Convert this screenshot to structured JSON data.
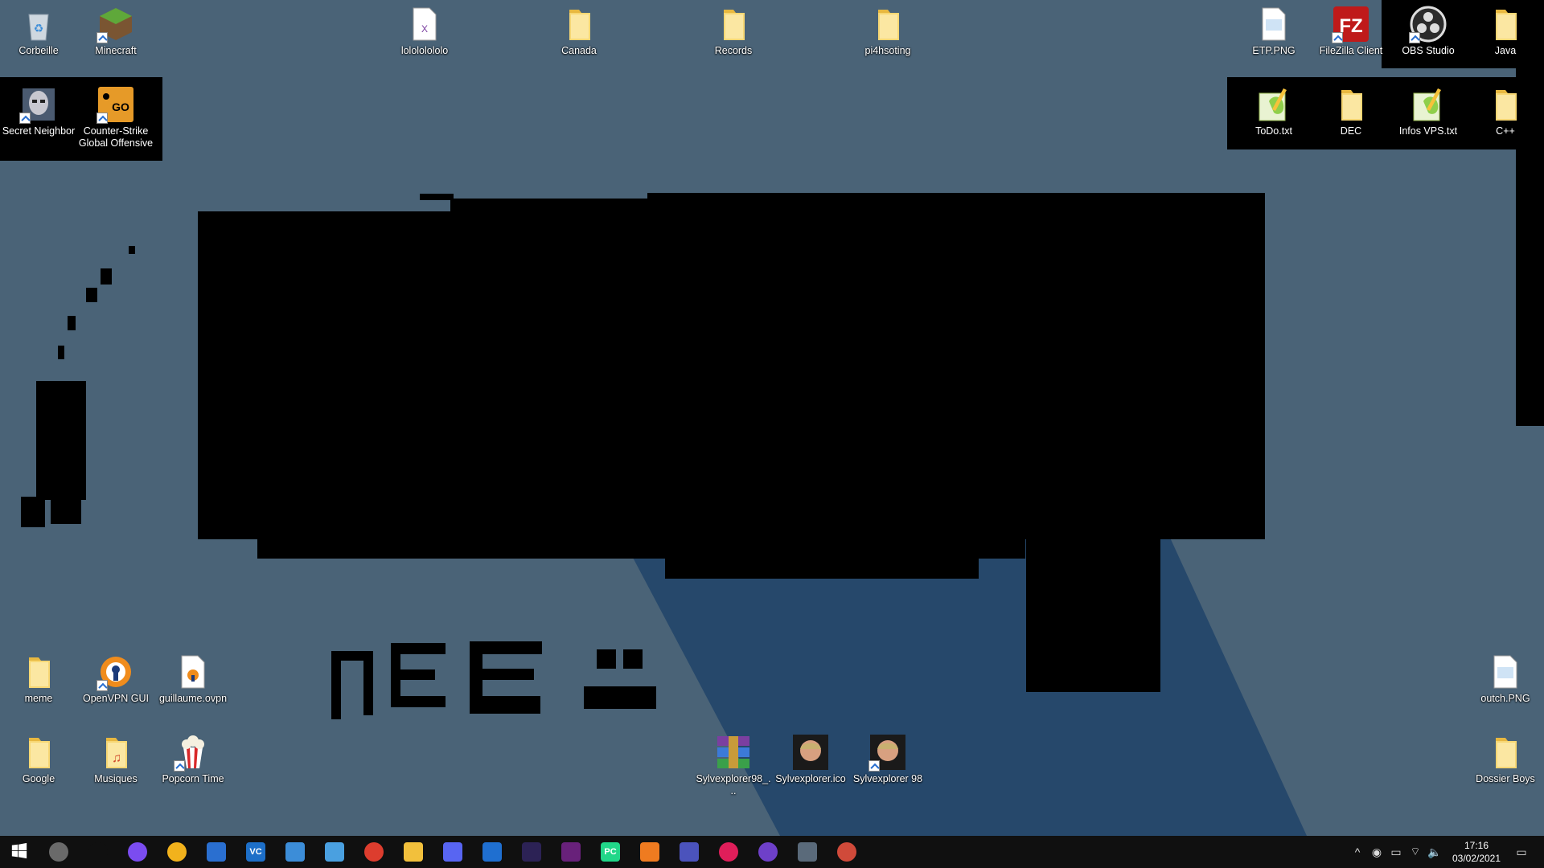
{
  "desktop": {
    "icons_left": [
      {
        "label": "Corbeille",
        "icon": "recycle-bin-icon"
      },
      {
        "label": "Minecraft",
        "icon": "minecraft-icon"
      },
      {
        "label": "Secret Neighbor",
        "icon": "secret-neighbor-icon"
      },
      {
        "label": "Counter-Strike Global Offensive",
        "icon": "csgo-icon"
      }
    ],
    "icons_top": [
      {
        "label": "lolololololo",
        "icon": "xml-file-icon"
      },
      {
        "label": "Canada",
        "icon": "folder-icon"
      },
      {
        "label": "Records",
        "icon": "folder-icon"
      },
      {
        "label": "pi4hsoting",
        "icon": "folder-icon"
      }
    ],
    "icons_right": [
      {
        "label": "ETP.PNG",
        "icon": "image-file-icon"
      },
      {
        "label": "FileZilla Client",
        "icon": "filezilla-icon"
      },
      {
        "label": "OBS Studio",
        "icon": "obs-icon"
      },
      {
        "label": "Java",
        "icon": "folder-icon"
      },
      {
        "label": "ToDo.txt",
        "icon": "notepadpp-file-icon"
      },
      {
        "label": "DEC",
        "icon": "folder-icon"
      },
      {
        "label": "Infos VPS.txt",
        "icon": "notepadpp-file-icon"
      },
      {
        "label": "C++",
        "icon": "folder-icon"
      },
      {
        "label": "outch.PNG",
        "icon": "image-file-icon"
      },
      {
        "label": "Dossier Boys",
        "icon": "folder-icon"
      }
    ],
    "icons_bottom_left": [
      {
        "label": "meme",
        "icon": "folder-icon"
      },
      {
        "label": "OpenVPN GUI",
        "icon": "openvpn-icon"
      },
      {
        "label": "guillaume.ovpn",
        "icon": "ovpn-file-icon"
      },
      {
        "label": "Google",
        "icon": "folder-icon"
      },
      {
        "label": "Musiques",
        "icon": "music-folder-icon"
      },
      {
        "label": "Popcorn Time",
        "icon": "popcorn-icon"
      }
    ],
    "icons_bottom_center": [
      {
        "label": "Sylvexplorer98_...",
        "icon": "winrar-icon"
      },
      {
        "label": "Sylvexplorer.ico",
        "icon": "portrait-icon"
      },
      {
        "label": "Sylvexplorer 98",
        "icon": "portrait-icon"
      }
    ],
    "drawing_text": "REE :-"
  },
  "taskbar": {
    "apps": [
      {
        "name": "start-icon",
        "glyph": ""
      },
      {
        "name": "cortana-icon",
        "glyph": ""
      },
      {
        "name": "speedometer-icon",
        "glyph": ""
      },
      {
        "name": "messenger-icon",
        "glyph": ""
      },
      {
        "name": "chat-alert-icon",
        "glyph": ""
      },
      {
        "name": "network-tool-icon",
        "glyph": ""
      },
      {
        "name": "vscode-icon",
        "glyph": "VC"
      },
      {
        "name": "control-panel-icon",
        "glyph": ""
      },
      {
        "name": "remote-desktop-icon",
        "glyph": ""
      },
      {
        "name": "chrome-icon",
        "glyph": ""
      },
      {
        "name": "file-explorer-icon",
        "glyph": ""
      },
      {
        "name": "discord-icon",
        "glyph": ""
      },
      {
        "name": "browser-icon",
        "glyph": ""
      },
      {
        "name": "eclipse-icon",
        "glyph": ""
      },
      {
        "name": "visual-studio-icon",
        "glyph": ""
      },
      {
        "name": "pycharm-icon",
        "glyph": "PC"
      },
      {
        "name": "sublime-icon",
        "glyph": ""
      },
      {
        "name": "teams-icon",
        "glyph": ""
      },
      {
        "name": "slack-icon",
        "glyph": ""
      },
      {
        "name": "github-icon",
        "glyph": ""
      },
      {
        "name": "calculator-icon",
        "glyph": ""
      },
      {
        "name": "paint-icon",
        "glyph": ""
      }
    ],
    "tray": [
      "^",
      "◉",
      "▭",
      "⌔",
      "🔈"
    ],
    "time": "17:16",
    "date": "03/02/2021",
    "notification_glyph": "▭"
  },
  "colors": {
    "wallpaper": "#4a6377",
    "beam": "#26486b",
    "taskbar": "#101010"
  }
}
